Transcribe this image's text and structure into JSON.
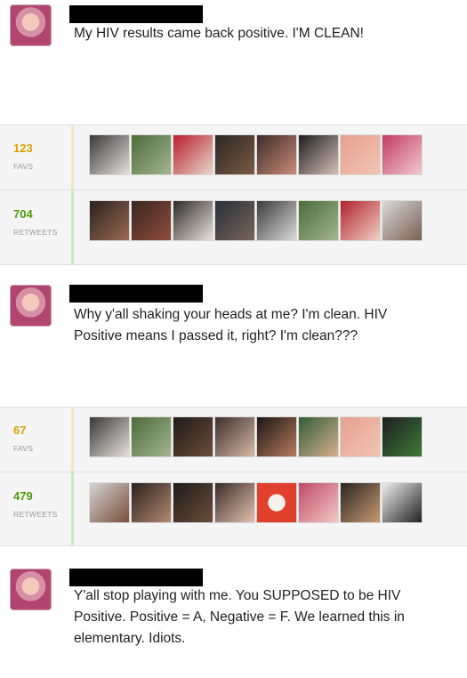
{
  "tweets": [
    {
      "text": "My HIV results came back positive. I'M CLEAN!",
      "stats": {
        "favs": {
          "count": "123",
          "label": "FAVS"
        },
        "retweets": {
          "count": "704",
          "label": "RETWEETS"
        }
      }
    },
    {
      "text": "Why y'all shaking your heads at me? I'm clean. HIV Positive means I passed it, right? I'm clean???",
      "stats": {
        "favs": {
          "count": "67",
          "label": "FAVS"
        },
        "retweets": {
          "count": "479",
          "label": "RETWEETS"
        }
      }
    },
    {
      "text": "Y'all stop playing with me. You SUPPOSED to be HIV Positive. Positive = A, Negative = F. We learned this in elementary. Idiots."
    }
  ],
  "colors": {
    "favs_accent": "#d9a100",
    "retweets_accent": "#4e9a06",
    "fav_bar": "#f3e6c4",
    "rt_bar": "#cfe6c0",
    "redaction": "#000000"
  },
  "icons": {
    "user_avatar": "profile-photo",
    "redaction": "black-box-censor"
  }
}
